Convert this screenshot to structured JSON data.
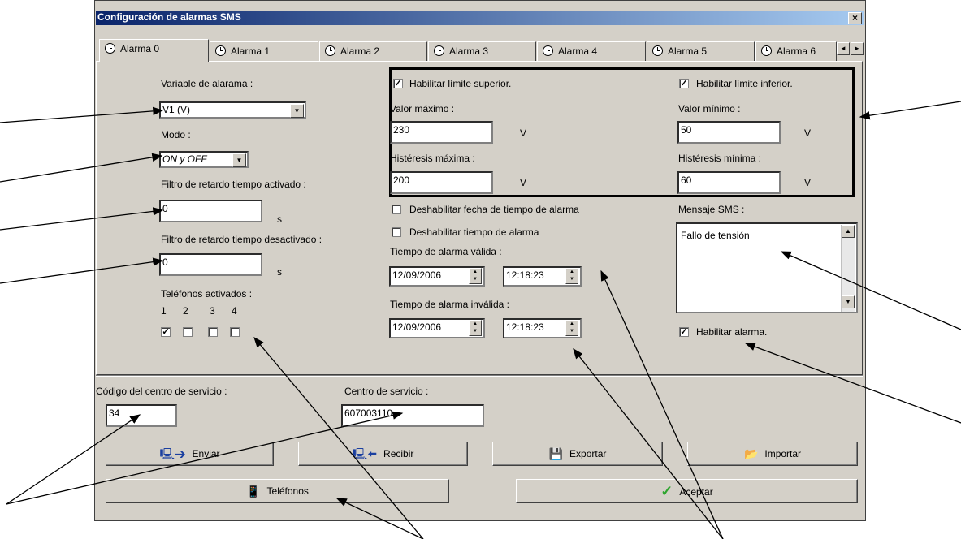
{
  "window": {
    "title": "Configuración de alarmas SMS",
    "close_label": "×"
  },
  "tabs": [
    "Alarma 0",
    "Alarma 1",
    "Alarma 2",
    "Alarma 3",
    "Alarma 4",
    "Alarma 5",
    "Alarma 6"
  ],
  "tab_scroll": {
    "left": "◄",
    "right": "►"
  },
  "left": {
    "variable_label": "Variable de alarama :",
    "variable_value": "V1 (V)",
    "modo_label": "Modo :",
    "modo_value": "ON y OFF",
    "filtro_on_label": "Filtro de retardo tiempo activado :",
    "filtro_on_value": "0",
    "filtro_on_unit": "s",
    "filtro_off_label": "Filtro de retardo tiempo desactivado :",
    "filtro_off_value": "0",
    "filtro_off_unit": "s",
    "telefonos_label": "Teléfonos activados :",
    "phones": [
      {
        "num": "1",
        "checked": true
      },
      {
        "num": "2",
        "checked": false
      },
      {
        "num": "3",
        "checked": false
      },
      {
        "num": "4",
        "checked": false
      }
    ]
  },
  "limits": {
    "upper_enable_label": "Habilitar límite superior.",
    "upper_enable_checked": true,
    "max_label": "Valor máximo :",
    "max_value": "230",
    "max_unit": "V",
    "hyst_max_label": "Histéresis máxima :",
    "hyst_max_value": "200",
    "hyst_max_unit": "V",
    "lower_enable_label": "Habilitar límite inferior.",
    "lower_enable_checked": true,
    "min_label": "Valor mínimo :",
    "min_value": "50",
    "min_unit": "V",
    "hyst_min_label": "Histéresis mínima :",
    "hyst_min_value": "60",
    "hyst_min_unit": "V"
  },
  "time": {
    "disable_date_label": "Deshabilitar fecha de tiempo de alarma",
    "disable_time_label": "Deshabilitar tiempo de alarma",
    "valid_label": "Tiempo de alarma válida :",
    "valid_date": "12/09/2006",
    "valid_time": "12:18:23",
    "invalid_label": "Tiempo de alarma inválida :",
    "invalid_date": "12/09/2006",
    "invalid_time": "12:18:23"
  },
  "sms": {
    "label": "Mensaje SMS :",
    "message": "Fallo de tensión",
    "enable_label": "Habilitar alarma.",
    "enable_checked": true
  },
  "bottom": {
    "codigo_label": "Código del centro de servicio :",
    "codigo_value": "34",
    "centro_label": "Centro de servicio :",
    "centro_value": "607003110"
  },
  "buttons": {
    "enviar": "Enviar",
    "recibir": "Recibir",
    "exportar": "Exportar",
    "importar": "Importar",
    "telefonos": "Teléfonos",
    "aceptar": "Aceptar"
  },
  "icons": {
    "clock": "clock-icon",
    "send": "send-icon",
    "receive": "receive-icon",
    "save": "floppy-icon",
    "folder": "folder-open-icon",
    "phone": "mobile-phone-icon",
    "check": "green-check-icon"
  },
  "colors": {
    "title_start": "#0a246a",
    "title_end": "#a6caf0",
    "face": "#d4d0c8",
    "check_green": "#2ea52e"
  }
}
